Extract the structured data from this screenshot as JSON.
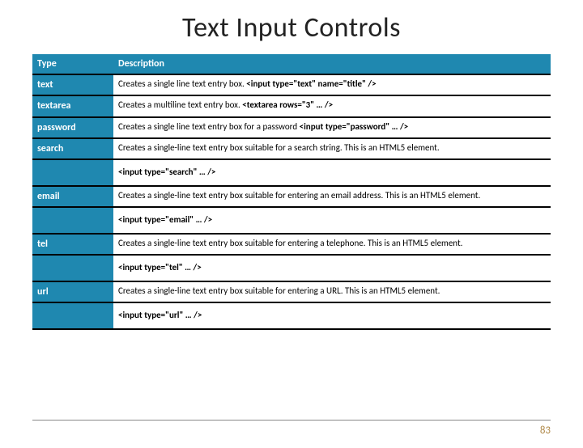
{
  "title": "Text Input Controls",
  "headers": {
    "type": "Type",
    "desc": "Description"
  },
  "rows": [
    {
      "type": "text",
      "desc": "Creates a single line text entry box.",
      "code": "<input type=\"text\" name=\"title\" />",
      "extra": null
    },
    {
      "type": "textarea",
      "desc": "Creates a multiline text entry box.",
      "code": "<textarea rows=\"3\" … />",
      "extra": null
    },
    {
      "type": "password",
      "desc": "Creates a single line text entry box for a password",
      "code": "<input type=\"password\" … />",
      "extra": null
    },
    {
      "type": "search",
      "desc": "Creates a single-line text entry box suitable for a search string. This is an HTML5 element.",
      "code": null,
      "extra": "<input type=\"search\" … />"
    },
    {
      "type": "email",
      "desc": "Creates a single-line text entry box suitable for entering an email address. This is an HTML5 element.",
      "code": null,
      "extra": "<input type=\"email\" … />"
    },
    {
      "type": "tel",
      "desc": "Creates a single-line text entry box suitable for entering a telephone. This is an HTML5 element.",
      "code": null,
      "extra": "<input type=\"tel\" … />"
    },
    {
      "type": "url",
      "desc": "Creates a single-line text entry box suitable for entering a URL. This is an HTML5 element.",
      "code": null,
      "extra": "<input type=\"url\" … />"
    }
  ],
  "page_number": "83"
}
